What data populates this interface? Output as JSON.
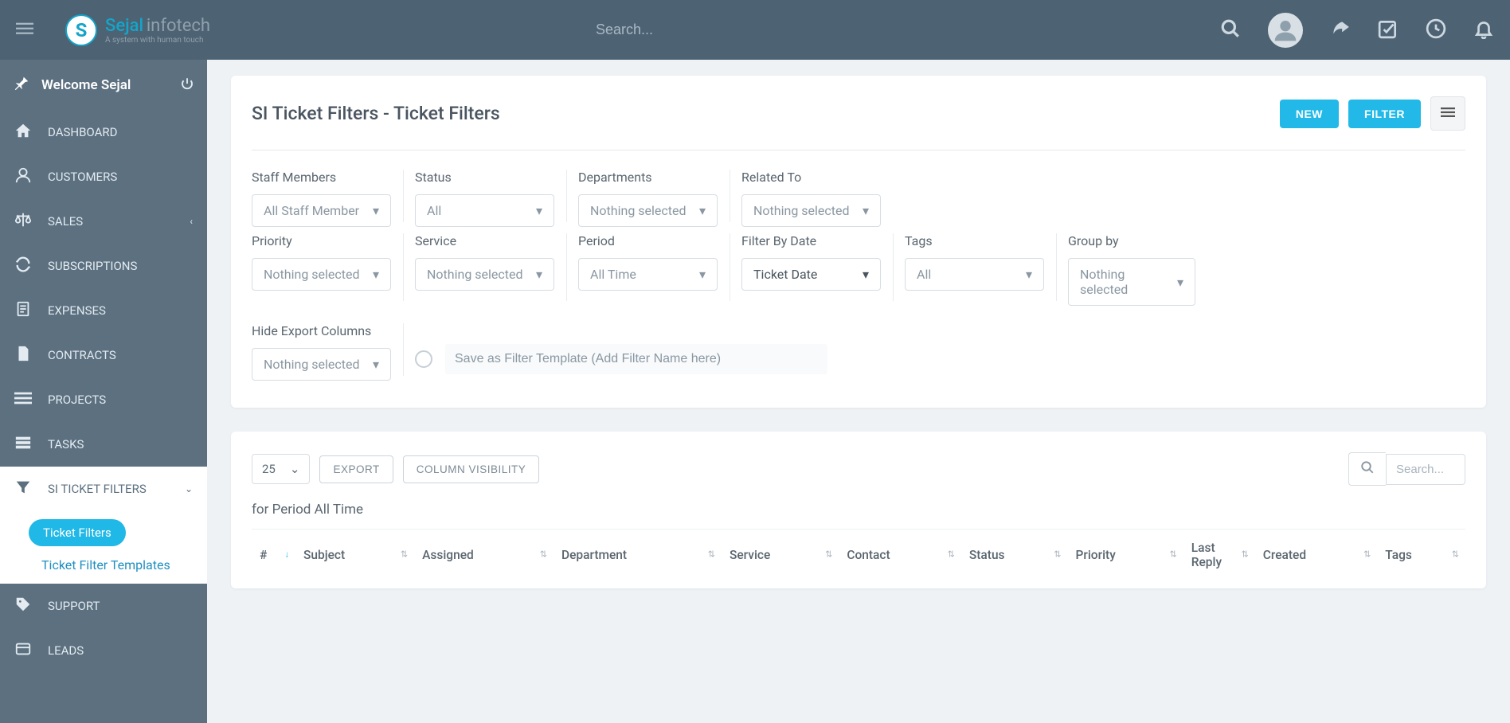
{
  "brand": {
    "name1": "Sejal",
    "name2": "infotech",
    "tagline": "A system with human touch",
    "badge": "S"
  },
  "topbar": {
    "search_placeholder": "Search..."
  },
  "sidebar": {
    "welcome": "Welcome Sejal",
    "items": [
      {
        "label": "DASHBOARD",
        "icon": "home-icon"
      },
      {
        "label": "CUSTOMERS",
        "icon": "user-icon"
      },
      {
        "label": "SALES",
        "icon": "scales-icon",
        "chev": true
      },
      {
        "label": "SUBSCRIPTIONS",
        "icon": "refresh-icon"
      },
      {
        "label": "EXPENSES",
        "icon": "document-icon"
      },
      {
        "label": "CONTRACTS",
        "icon": "file-icon"
      },
      {
        "label": "PROJECTS",
        "icon": "bars-icon"
      },
      {
        "label": "TASKS",
        "icon": "stack-icon"
      },
      {
        "label": "SI TICKET FILTERS",
        "icon": "filter-icon",
        "expanded": true,
        "chev": true,
        "children": [
          {
            "label": "Ticket Filters",
            "active": true
          },
          {
            "label": "Ticket Filter Templates"
          }
        ]
      },
      {
        "label": "SUPPORT",
        "icon": "tag-icon"
      },
      {
        "label": "LEADS",
        "icon": "card-icon"
      }
    ]
  },
  "page": {
    "title": "SI Ticket Filters - Ticket Filters",
    "btn_new": "NEW",
    "btn_filter": "FILTER"
  },
  "filters": {
    "staff_label": "Staff Members",
    "staff_value": "All Staff Member",
    "status_label": "Status",
    "status_value": "All",
    "dept_label": "Departments",
    "dept_value": "Nothing selected",
    "related_label": "Related To",
    "related_value": "Nothing selected",
    "priority_label": "Priority",
    "priority_value": "Nothing selected",
    "service_label": "Service",
    "service_value": "Nothing selected",
    "period_label": "Period",
    "period_value": "All Time",
    "filterdate_label": "Filter By Date",
    "filterdate_value": "Ticket Date",
    "tags_label": "Tags",
    "tags_value": "All",
    "groupby_label": "Group by",
    "groupby_value": "Nothing selected",
    "hideexport_label": "Hide Export Columns",
    "hideexport_value": "Nothing selected",
    "save_placeholder": "Save as Filter Template (Add Filter Name here)"
  },
  "results": {
    "page_size": "25",
    "btn_export": "EXPORT",
    "btn_colvis": "COLUMN VISIBILITY",
    "search_placeholder": "Search...",
    "period_text": "for Period All Time",
    "columns": [
      "#",
      "Subject",
      "Assigned",
      "Department",
      "Service",
      "Contact",
      "Status",
      "Priority",
      "Last Reply",
      "Created",
      "Tags"
    ]
  }
}
